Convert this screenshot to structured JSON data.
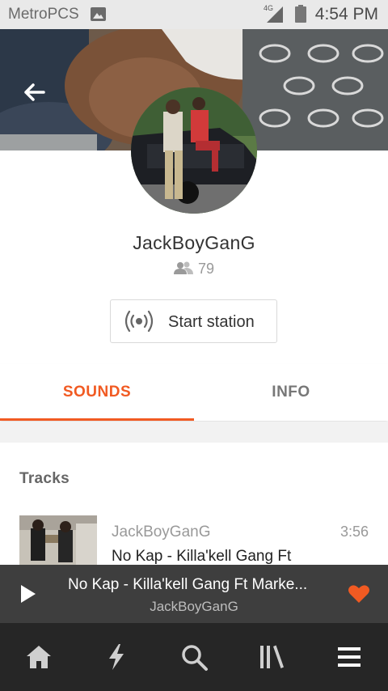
{
  "status_bar": {
    "carrier": "MetroPCS",
    "network": "4G",
    "time": "4:54 PM"
  },
  "header": {
    "back_icon": "arrow-back-icon"
  },
  "profile": {
    "name": "JackBoyGanG",
    "followers_icon": "people-icon",
    "followers": "79",
    "station_icon": "radio-broadcast-icon",
    "station_label": "Start station"
  },
  "tabs": [
    {
      "label": "SOUNDS",
      "active": true
    },
    {
      "label": "INFO",
      "active": false
    }
  ],
  "tracks": {
    "heading": "Tracks",
    "items": [
      {
        "artist": "JackBoyGanG",
        "duration": "3:56",
        "title": "No Kap - Killa'kell Gang Ft"
      }
    ]
  },
  "player": {
    "title": "No Kap - Killa'kell Gang Ft Marke...",
    "artist": "JackBoyGanG",
    "liked": true
  },
  "nav": [
    {
      "icon": "home-icon"
    },
    {
      "icon": "stream-bolt-icon"
    },
    {
      "icon": "search-icon"
    },
    {
      "icon": "library-icon"
    },
    {
      "icon": "menu-icon"
    }
  ],
  "colors": {
    "accent": "#f15a22",
    "player_bg": "#3e3e3e",
    "nav_bg": "#262626"
  }
}
